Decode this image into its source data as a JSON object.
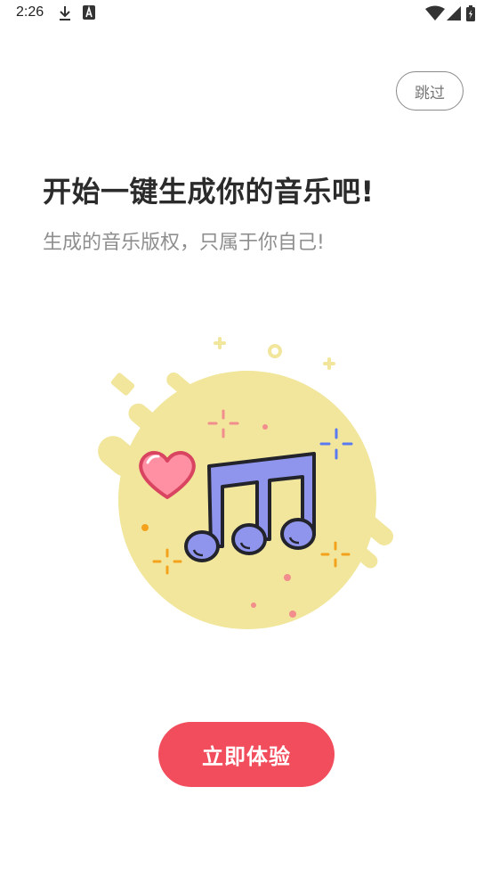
{
  "status_bar": {
    "time": "2:26",
    "left_icons": [
      "download-icon",
      "font-a-icon"
    ],
    "right_icons": [
      "wifi-icon",
      "signal-icon",
      "battery-icon"
    ]
  },
  "skip_label": "跳过",
  "headline": "开始一键生成你的音乐吧!",
  "subtitle": "生成的音乐版权，只属于你自己!",
  "illustration": {
    "icons": [
      "music-notes-icon",
      "heart-icon",
      "sparkle-icon"
    ],
    "colors": {
      "blob": "#f1e69b",
      "notes": "#8f95ec",
      "heart": "#ff8fa3",
      "accent_orange": "#f4a21c",
      "accent_blue": "#5a7bf0",
      "accent_pink": "#f28d8d"
    }
  },
  "cta_label": "立即体验",
  "colors": {
    "accent": "#f14d5c",
    "text_primary": "#2b2b2b",
    "text_secondary": "#8e8e8e"
  }
}
